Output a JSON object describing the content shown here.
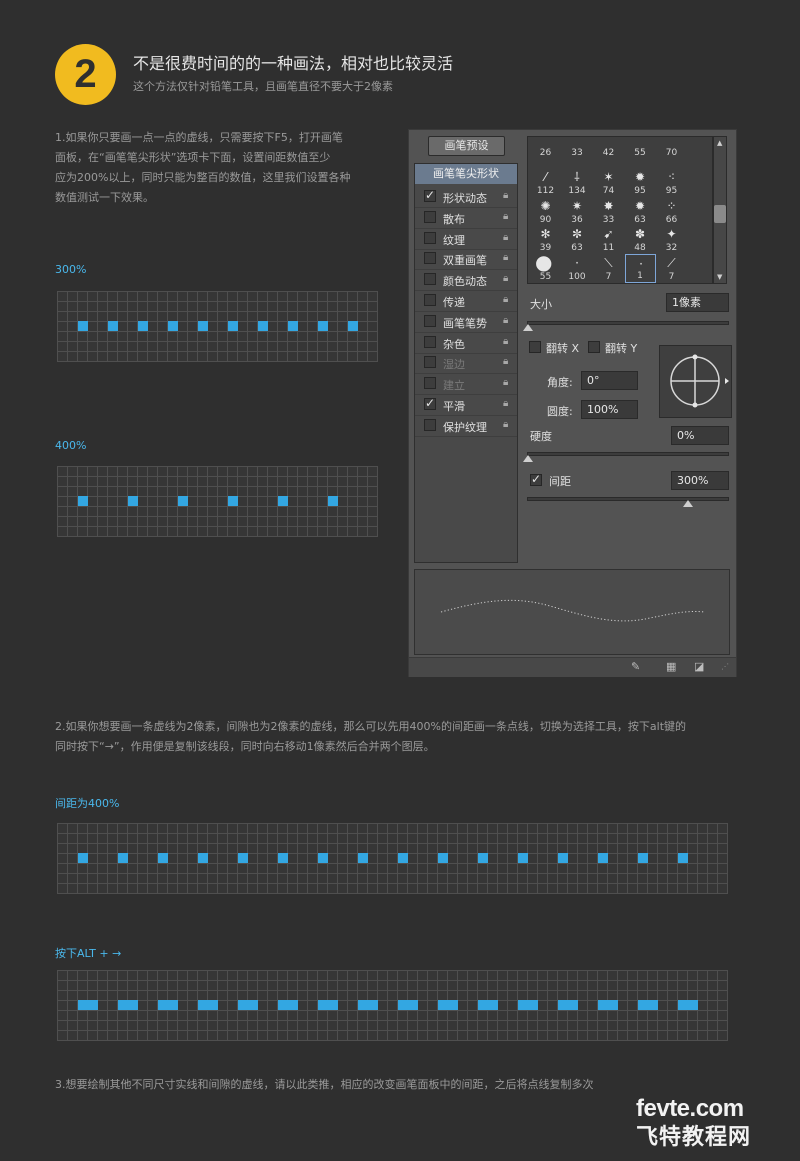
{
  "header": {
    "step_number": "2",
    "title": "不是很费时间的的一种画法，相对也比较灵活",
    "subtitle": "这个方法仅针对铅笔工具，且画笔直径不要大于2像素"
  },
  "step1": {
    "lines": [
      "1.如果你只要画一点一点的虚线，只需要按下F5，打开画笔",
      "面板，在“画笔笔尖形状”选项卡下面，设置间距数值至少",
      "应为200%以上，同时只能为整百的数值，这里我们设置各种",
      "数值测试一下效果。"
    ]
  },
  "grid300": {
    "label": "300%",
    "dot_count": 10
  },
  "grid400": {
    "label": "400%",
    "dot_count": 6
  },
  "brush_panel": {
    "preset_button": "画笔预设",
    "tab_title": "画笔笔尖形状",
    "options": [
      {
        "label": "形状动态",
        "checked": true,
        "enabled": true
      },
      {
        "label": "散布",
        "checked": false,
        "enabled": true
      },
      {
        "label": "纹理",
        "checked": false,
        "enabled": true
      },
      {
        "label": "双重画笔",
        "checked": false,
        "enabled": true
      },
      {
        "label": "颜色动态",
        "checked": false,
        "enabled": true
      },
      {
        "label": "传递",
        "checked": false,
        "enabled": true
      },
      {
        "label": "画笔笔势",
        "checked": false,
        "enabled": true
      },
      {
        "label": "杂色",
        "checked": false,
        "enabled": true
      },
      {
        "label": "湿边",
        "checked": false,
        "enabled": false
      },
      {
        "label": "建立",
        "checked": false,
        "enabled": false
      },
      {
        "label": "平滑",
        "checked": true,
        "enabled": true
      },
      {
        "label": "保护纹理",
        "checked": false,
        "enabled": true
      }
    ],
    "brush_sizes": [
      [
        "26",
        "33",
        "42",
        "55",
        "70"
      ],
      [
        "112",
        "134",
        "74",
        "95",
        "95"
      ],
      [
        "90",
        "36",
        "33",
        "63",
        "66"
      ],
      [
        "39",
        "63",
        "11",
        "48",
        "32"
      ],
      [
        "55",
        "100",
        "7",
        "1",
        "7"
      ]
    ],
    "selected_brush_size": "1",
    "size_label": "大小",
    "size_value": "1像素",
    "flip_x_label": "翻转 X",
    "flip_y_label": "翻转 Y",
    "angle_label": "角度:",
    "angle_value": "0°",
    "roundness_label": "圆度:",
    "roundness_value": "100%",
    "hardness_label": "硬度",
    "hardness_value": "0%",
    "spacing_label": "间距",
    "spacing_checked": true,
    "spacing_value": "300%"
  },
  "step2": {
    "lines": [
      "2.如果你想要画一条虚线为2像素，间隙也为2像素的虚线，那么可以先用400%的间距画一条点线，切换为选择工具，按下alt键的",
      "同时按下“→”，作用便是复制该线段，同时向右移动1像素然后合并两个图层。"
    ]
  },
  "grid_spacing400": {
    "label": "间距为400%",
    "dot_count": 16
  },
  "grid_alt": {
    "label": "按下ALT + →",
    "dot_count": 16
  },
  "step3": {
    "line": "3.想要绘制其他不同尺寸实线和间隙的虚线，请以此类推，相应的改变画笔面板中的间距，之后将点线复制多次"
  },
  "watermark": {
    "line1": "fevte.com",
    "line2": "飞特教程网"
  },
  "colors": {
    "accent": "#33a7e2",
    "badge": "#f1bb1f",
    "background": "#2f2f2f"
  }
}
